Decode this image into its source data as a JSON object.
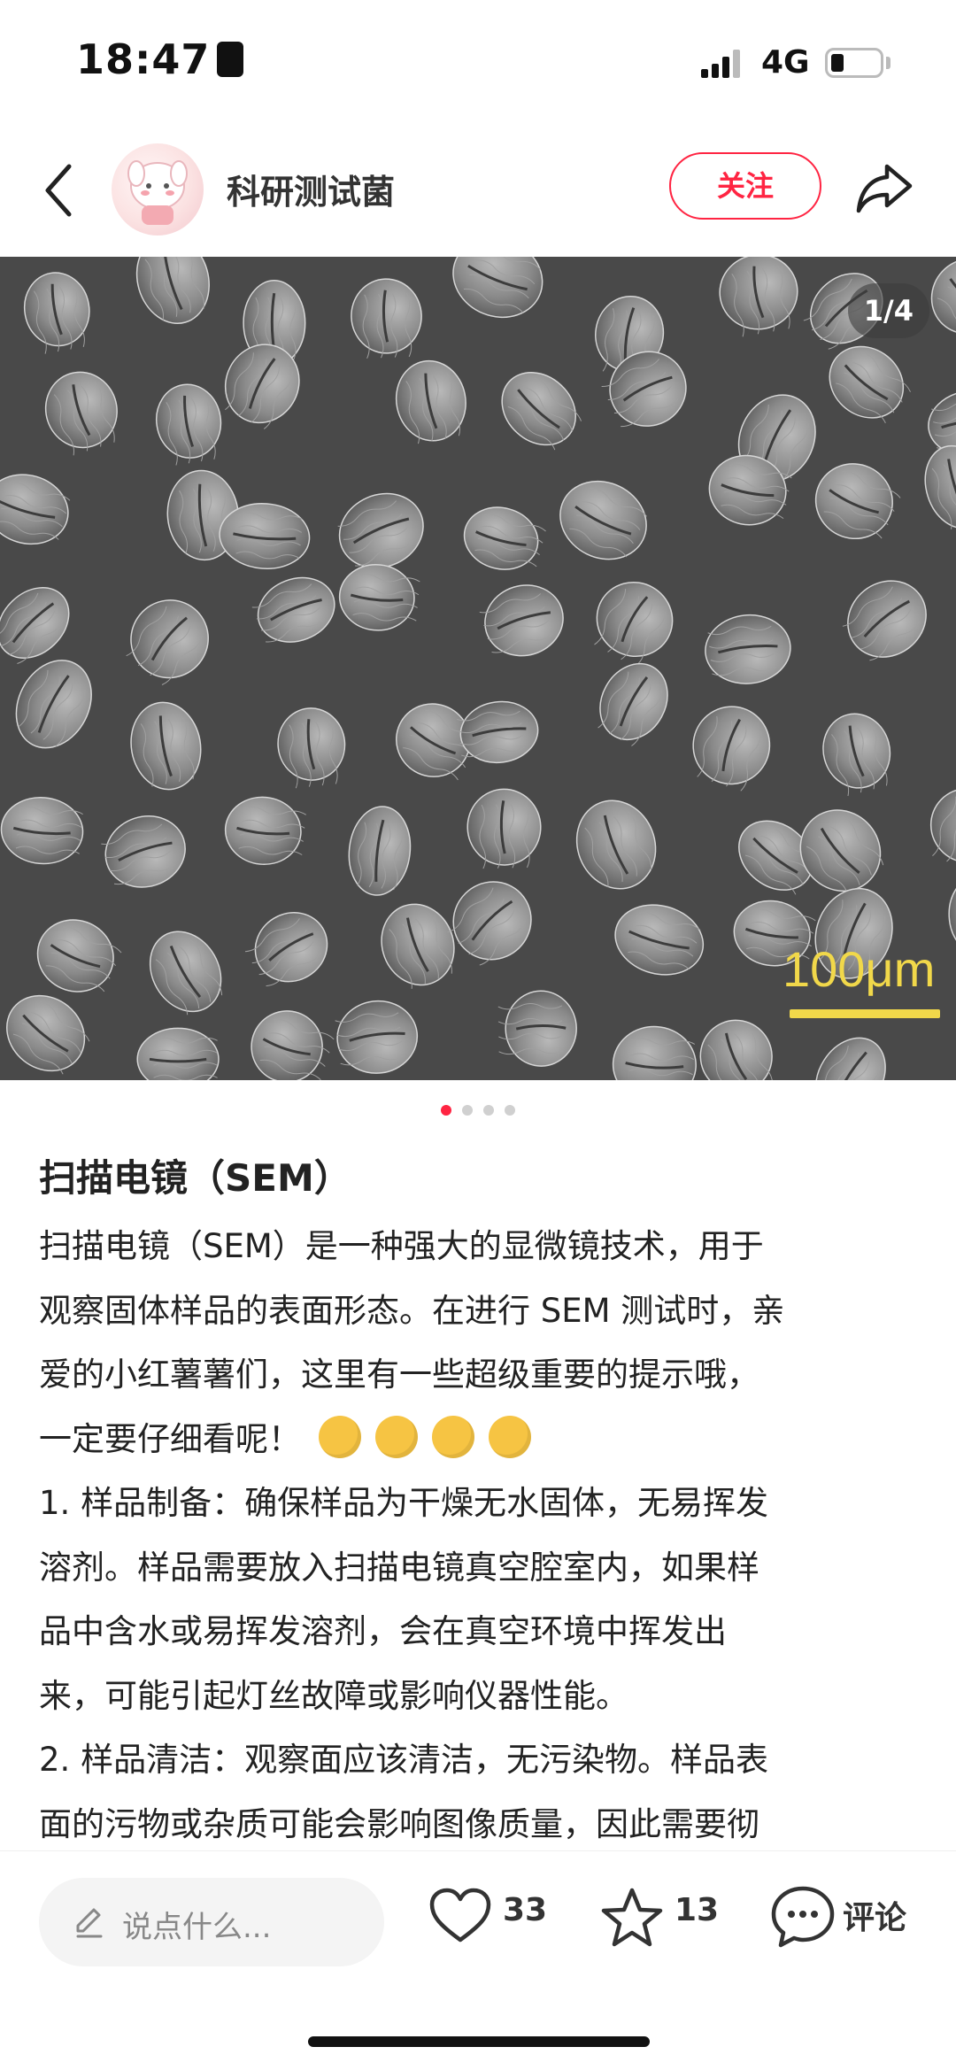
{
  "status": {
    "time": "18:47",
    "network": "4G"
  },
  "header": {
    "author": "科研测试菌",
    "follow_label": "关注"
  },
  "carousel": {
    "counter": "1/4",
    "scale_label": "100μm",
    "page_count": 4,
    "active_index": 0
  },
  "post": {
    "title": "扫描电镜（SEM）",
    "lines": [
      "扫描电镜（SEM）是一种强大的显微镜技术，用于",
      "观察固体样品的表面形态。在进行 SEM 测试时，亲",
      "爱的小红薯薯们，这里有一些超级重要的提示哦，",
      "一定要仔细看呢！",
      "1. 样品制备：确保样品为干燥无水固体，无易挥发",
      "溶剂。样品需要放入扫描电镜真空腔室内，如果样",
      "品中含水或易挥发溶剂，会在真空环境中挥发出",
      "来，可能引起灯丝故障或影响仪器性能。",
      "2. 样品清洁：观察面应该清洁，无污染物。样品表",
      "面的污物或杂质可能会影响图像质量，因此需要彻"
    ],
    "emoji_icon": "monocle-face-emoji"
  },
  "bottom_bar": {
    "comment_placeholder": "说点什么...",
    "like_count": "33",
    "collect_count": "13",
    "comment_label": "评论"
  },
  "colors": {
    "accent": "#ff2442",
    "scale": "#f1d84a",
    "sem_bg": "#4a4a4a"
  }
}
